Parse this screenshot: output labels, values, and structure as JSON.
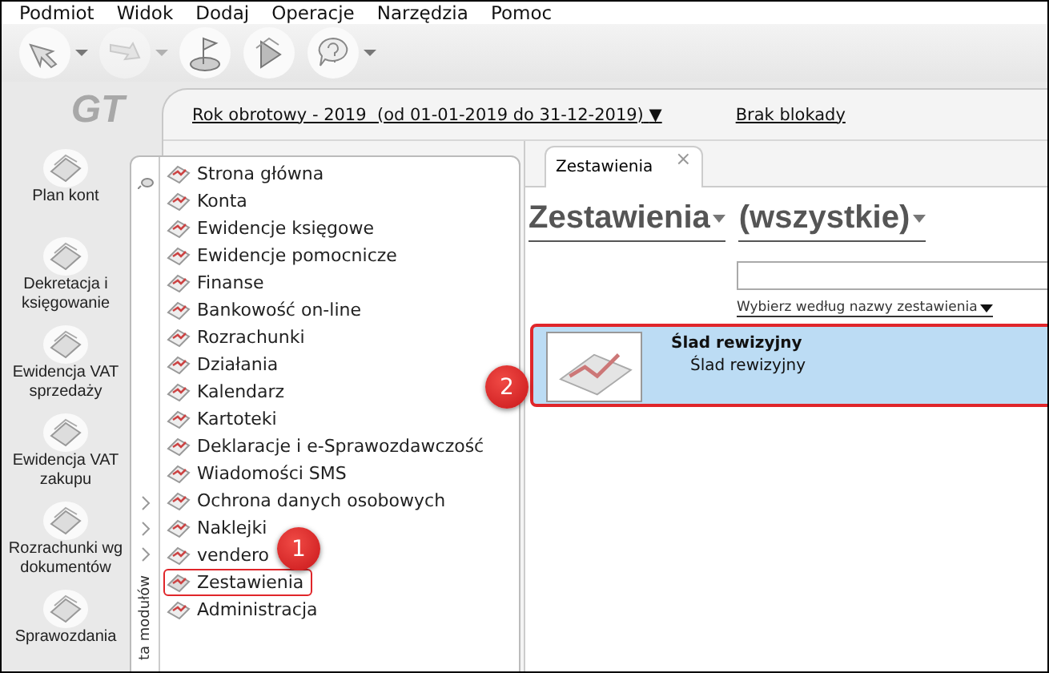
{
  "menu": [
    "Podmiot",
    "Widok",
    "Dodaj",
    "Operacje",
    "Narzędzia",
    "Pomoc"
  ],
  "toolbar": [
    {
      "kind": "back",
      "dropdown": true,
      "disabled": false
    },
    {
      "kind": "forward",
      "dropdown": true,
      "disabled": true
    },
    {
      "kind": "flag",
      "dropdown": false,
      "disabled": false
    },
    {
      "kind": "run",
      "dropdown": false,
      "disabled": false
    },
    {
      "kind": "help",
      "dropdown": true,
      "disabled": false
    }
  ],
  "logo": "GT",
  "shortcuts": [
    {
      "label": "Plan kont"
    },
    {
      "label": "Dekretacja i księgowanie"
    },
    {
      "label": "Ewidencja VAT sprzedaży"
    },
    {
      "label": "Ewidencja VAT zakupu"
    },
    {
      "label": "Rozrachunki wg dokumentów"
    },
    {
      "label": "Sprawozdania"
    }
  ],
  "header": {
    "period": "Rok obrotowy - 2019  (od 01-01-2019 do 31-12-2019)",
    "period_caret": "▼",
    "lock": "Brak blokady"
  },
  "module_menu": {
    "side_label": "ta modułów",
    "items": [
      {
        "label": "Strona główna",
        "highlighted": false
      },
      {
        "label": "Konta",
        "highlighted": false
      },
      {
        "label": "Ewidencje księgowe",
        "highlighted": false
      },
      {
        "label": "Ewidencje pomocnicze",
        "highlighted": false
      },
      {
        "label": "Finanse",
        "highlighted": false
      },
      {
        "label": "Bankowość on-line",
        "highlighted": false
      },
      {
        "label": "Rozrachunki",
        "highlighted": false
      },
      {
        "label": "Działania",
        "highlighted": false
      },
      {
        "label": "Kalendarz",
        "highlighted": false
      },
      {
        "label": "Kartoteki",
        "highlighted": false
      },
      {
        "label": "Deklaracje i e-Sprawozdawczość",
        "highlighted": false
      },
      {
        "label": "Wiadomości SMS",
        "highlighted": false
      },
      {
        "label": "Ochrona danych osobowych",
        "highlighted": false
      },
      {
        "label": "Naklejki",
        "highlighted": false
      },
      {
        "label": "vendero",
        "highlighted": false
      },
      {
        "label": "Zestawienia",
        "highlighted": true
      },
      {
        "label": "Administracja",
        "highlighted": false
      }
    ]
  },
  "tabs": [
    {
      "label": "Zestawienia",
      "selected": true,
      "close": "×"
    }
  ],
  "panel": {
    "title": "Zestawienia",
    "filter": "(wszystkie)",
    "sort": "Wybierz według nazwy zestawienia",
    "reports": [
      {
        "title": "Ślad rewizyjny",
        "subtitle": "Ślad rewizyjny",
        "selected": true
      }
    ]
  },
  "callouts": [
    {
      "number": "1"
    },
    {
      "number": "2"
    }
  ]
}
